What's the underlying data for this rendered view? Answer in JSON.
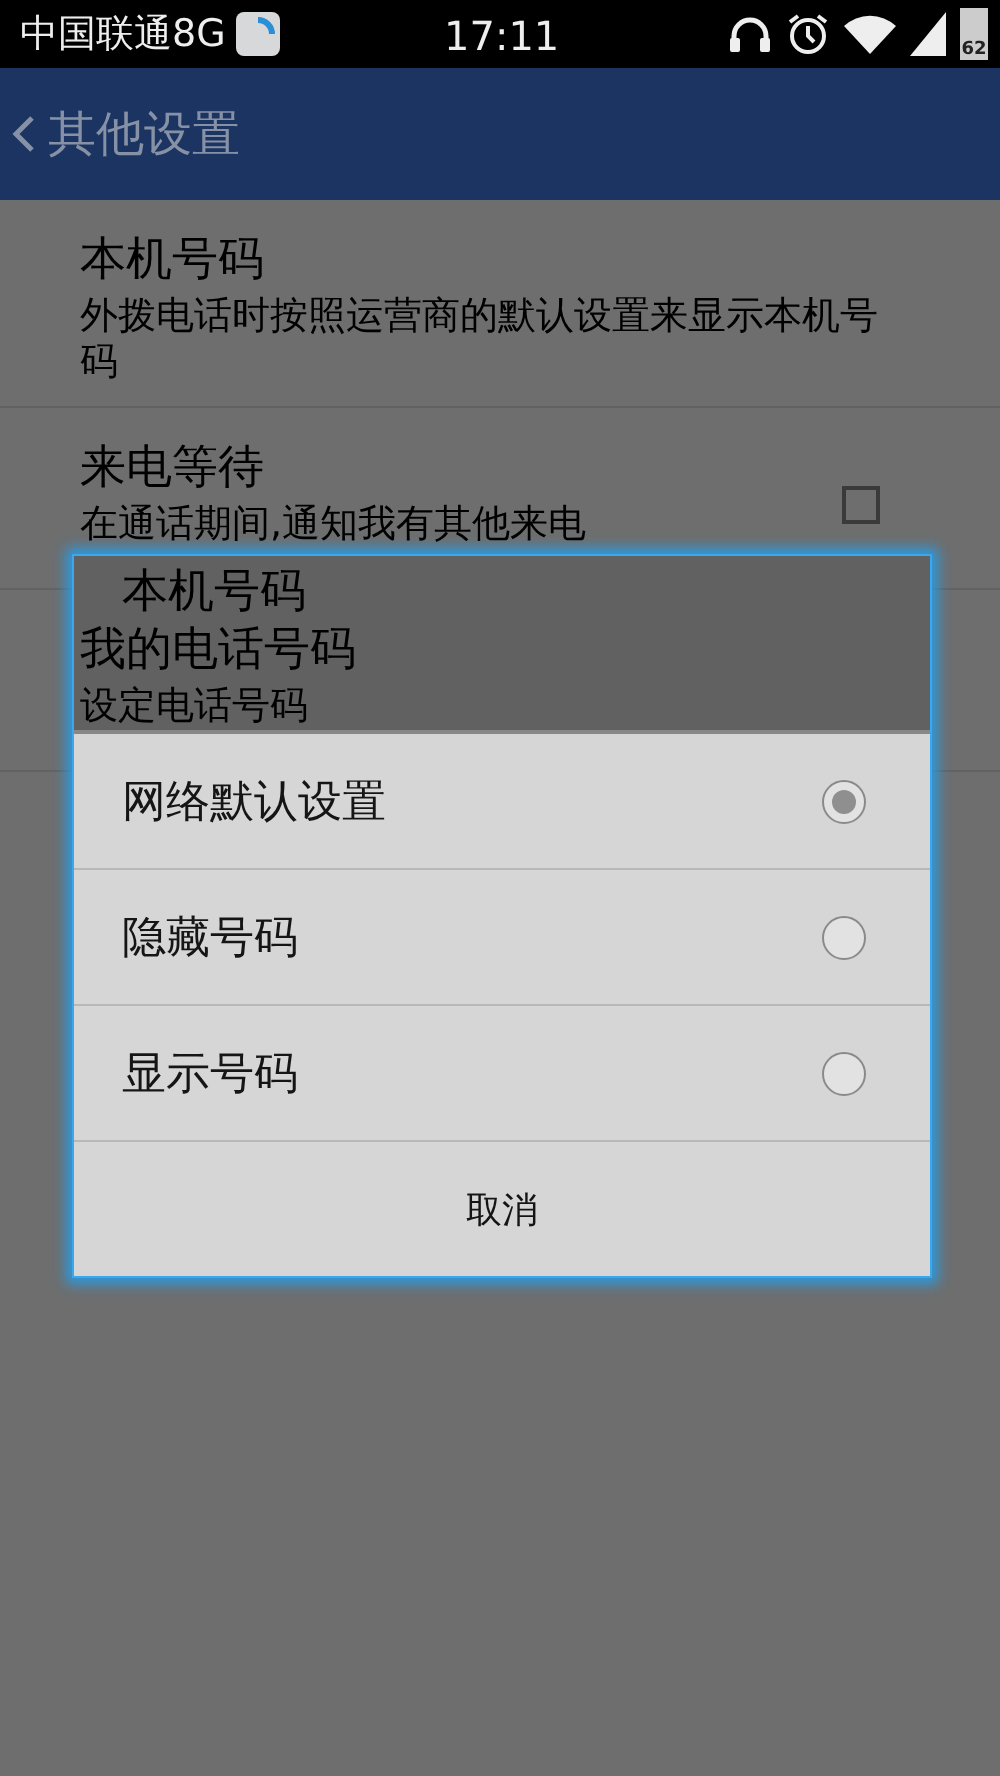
{
  "status_bar": {
    "carrier": "中国联通8G",
    "time": "17:11",
    "battery": "62"
  },
  "app_bar": {
    "title": "其他设置"
  },
  "settings": [
    {
      "kind": "text",
      "title": "本机号码",
      "summary": "外拨电话时按照运营商的默认设置来显示本机号码"
    },
    {
      "kind": "checkbox",
      "title": "来电等待",
      "summary": "在通话期间,通知我有其他来电",
      "checked": false
    },
    {
      "kind": "text",
      "title": "我的电话号码",
      "summary": "设定电话号码"
    }
  ],
  "dialog": {
    "title": "本机号码",
    "options": [
      {
        "label": "网络默认设置",
        "selected": true
      },
      {
        "label": "隐藏号码",
        "selected": false
      },
      {
        "label": "显示号码",
        "selected": false
      }
    ],
    "cancel": "取消"
  }
}
